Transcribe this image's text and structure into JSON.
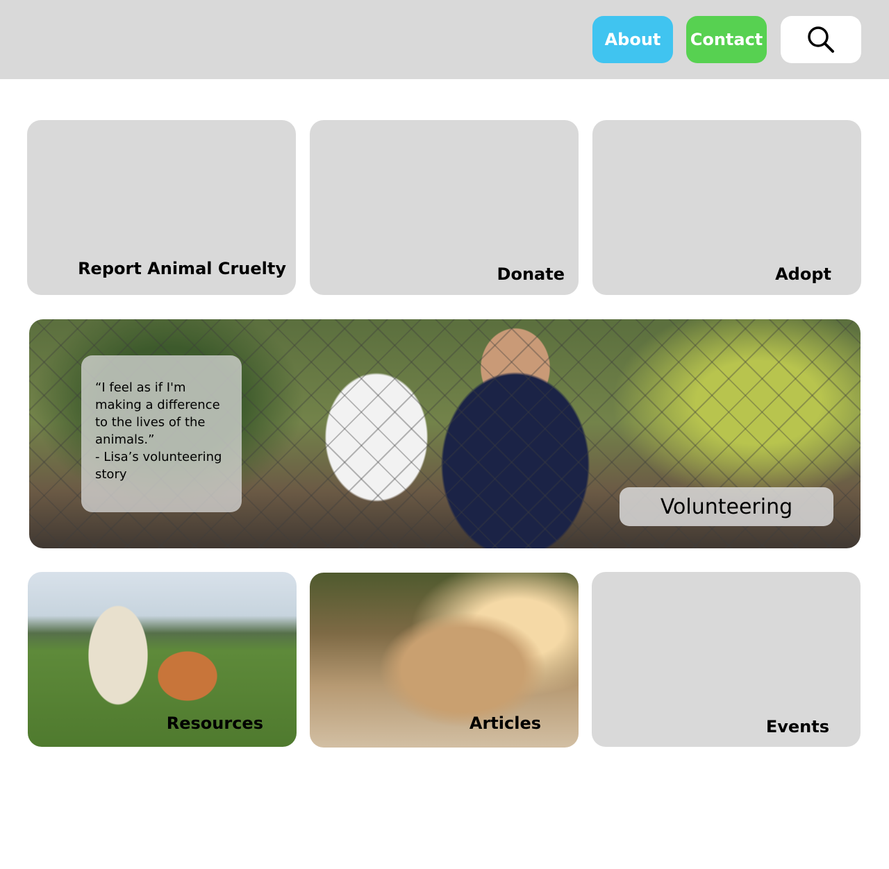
{
  "header": {
    "about_label": "About",
    "contact_label": "Contact",
    "search_icon": "search-icon"
  },
  "cards_top": [
    {
      "label": "Report Animal Cruelty"
    },
    {
      "label": "Donate"
    },
    {
      "label": "Adopt"
    }
  ],
  "feature": {
    "quote": "“I feel as if I'm\nmaking a difference\nto the lives of the\nanimals.”\n- Lisa’s volunteering\nstory",
    "label": "Volunteering"
  },
  "cards_bottom": [
    {
      "label": "Resources"
    },
    {
      "label": "Articles"
    },
    {
      "label": "Events"
    }
  ],
  "colors": {
    "about": "#40c4f0",
    "contact": "#57d151",
    "header_bg": "#d9d9d9",
    "card_bg": "#d9d9d9"
  }
}
